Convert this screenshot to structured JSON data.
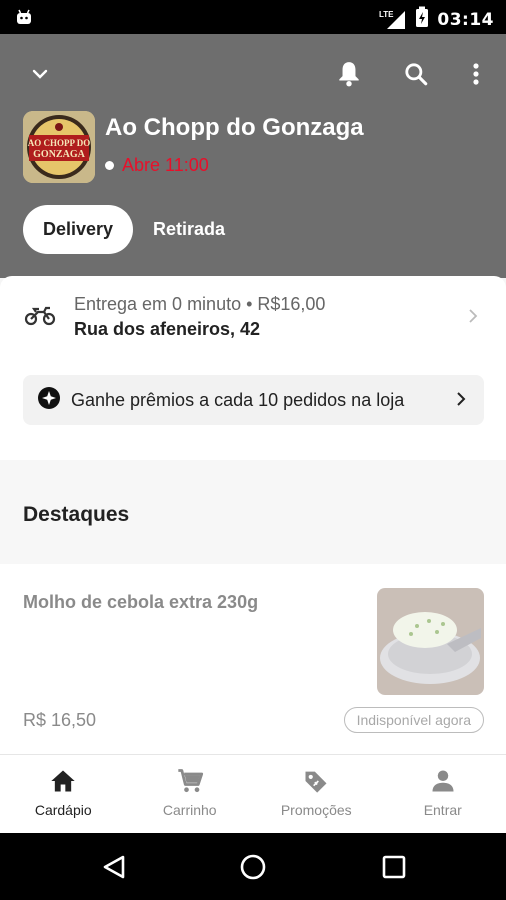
{
  "status_bar": {
    "time": "03:14",
    "network": "LTE"
  },
  "header": {
    "store_name": "Ao Chopp do Gonzaga",
    "open_status": "Abre 11:00",
    "logo_text": "AO CHOPP DO GONZAGA",
    "tabs": [
      {
        "label": "Delivery",
        "active": true
      },
      {
        "label": "Retirada",
        "active": false
      }
    ]
  },
  "delivery": {
    "estimate": "Entrega em 0 minuto • R$16,00",
    "address": "Rua dos afeneiros, 42"
  },
  "rewards": {
    "label": "Ganhe prêmios a cada 10 pedidos na loja"
  },
  "section": {
    "title": "Destaques"
  },
  "product": {
    "name": "Molho de cebola extra 230g",
    "price": "R$ 16,50",
    "availability": "Indisponível agora"
  },
  "bottom_nav": [
    {
      "label": "Cardápio",
      "icon": "home-icon",
      "active": true
    },
    {
      "label": "Carrinho",
      "icon": "cart-icon",
      "active": false
    },
    {
      "label": "Promoções",
      "icon": "tag-icon",
      "active": false
    },
    {
      "label": "Entrar",
      "icon": "person-icon",
      "active": false
    }
  ],
  "colors": {
    "header_bg": "#6e6e6e",
    "open_status": "#e8102a",
    "accent_text": "#222222"
  }
}
